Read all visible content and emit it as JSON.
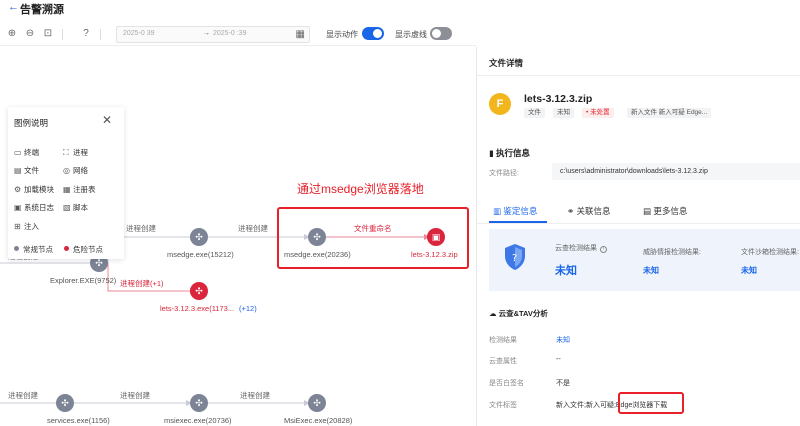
{
  "header": {
    "back_icon": "arrow-left",
    "title": "告警溯源"
  },
  "toolbar": {
    "time_start": "2025-0          39",
    "time_end": "2025-0          :39",
    "show_action_label": "显示动作",
    "show_action_on": true,
    "show_dashed_label": "显示虚线",
    "show_dashed_on": false
  },
  "legend": {
    "title": "图例说明",
    "items": [
      "终端",
      "进程",
      "文件",
      "网络",
      "加载模块",
      "注册表",
      "系统日志",
      "脚本",
      "注入"
    ],
    "normal_node": "常规节点",
    "danger_node": "危险节点",
    "colors": {
      "normal": "#7c8495",
      "danger": "#d9263c"
    }
  },
  "graph": {
    "edge_create": "进程创建",
    "edge_create_plus": "进程创建(+1)",
    "edge_rename": "文件重命名",
    "nodes": {
      "explorer": "Explorer.EXE(9752)",
      "msedge1": "msedge.exe(15212)",
      "msedge2": "msedge.exe(20236)",
      "zip": "lets-3.12.3.zip",
      "lets_exe": "lets-3.12.3.exe(1173...",
      "services": "services.exe(1156)",
      "msiexec": "msiexec.exe(20736)",
      "msiexec2": "MsiExec.exe(20828)"
    },
    "more": "(+12)",
    "annotation": "通过msedge浏览器落地"
  },
  "panel": {
    "title": "文件详情",
    "file_name": "lets-3.12.3.zip",
    "tags": [
      "文件",
      "未知",
      "• 未处置",
      "新入文件 新入可疑 Edge..."
    ],
    "exec_title": "执行信息",
    "path_label": "文件路径:",
    "path_value": "c:\\users\\administrator\\downloads\\lets-3.12.3.zip",
    "tabs": [
      "鉴定信息",
      "关联信息",
      "更多信息"
    ],
    "verdict": {
      "cloud_label": "云查检测结果",
      "cloud_value": "未知",
      "intel_label": "威胁情报检测结果:",
      "intel_value": "未知",
      "sandbox_label": "文件沙箱检测结果:",
      "sandbox_value": "未知"
    },
    "tav_title": "云查&TAV分析",
    "rows": [
      {
        "key": "检测结果",
        "value": "未知"
      },
      {
        "key": "云查属性",
        "value": "--"
      },
      {
        "key": "是否白签名",
        "value": "不是"
      },
      {
        "key": "文件标签",
        "value": "新入文件;新入可疑;Edge浏览器下载"
      }
    ]
  }
}
